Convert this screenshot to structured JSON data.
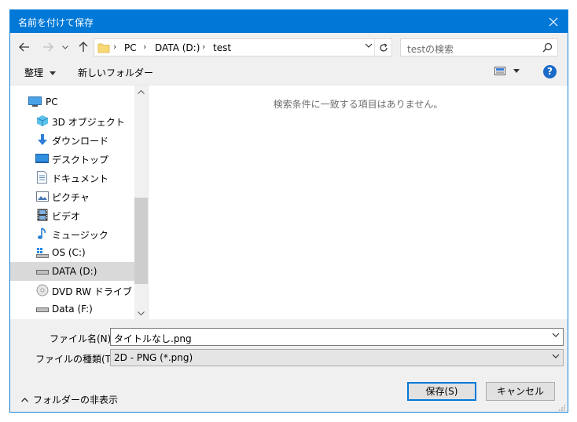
{
  "window": {
    "title": "名前を付けて保存"
  },
  "address": {
    "crumbs": [
      "PC",
      "DATA (D:)",
      "test"
    ]
  },
  "search": {
    "placeholder": "testの検索"
  },
  "toolbar": {
    "organize": "整理",
    "new_folder": "新しいフォルダー"
  },
  "nav": {
    "items": [
      {
        "label": "PC",
        "icon": "pc-icon"
      },
      {
        "label": "3D オブジェクト",
        "icon": "3d-objects-icon"
      },
      {
        "label": "ダウンロード",
        "icon": "downloads-icon"
      },
      {
        "label": "デスクトップ",
        "icon": "desktop-icon"
      },
      {
        "label": "ドキュメント",
        "icon": "documents-icon"
      },
      {
        "label": "ピクチャ",
        "icon": "pictures-icon"
      },
      {
        "label": "ビデオ",
        "icon": "videos-icon"
      },
      {
        "label": "ミュージック",
        "icon": "music-icon"
      },
      {
        "label": "OS (C:)",
        "icon": "os-drive-icon"
      },
      {
        "label": "DATA (D:)",
        "icon": "data-drive-icon",
        "selected": true
      },
      {
        "label": "DVD RW ドライブ (E:)",
        "icon": "dvd-drive-icon"
      },
      {
        "label": "Data (F:)",
        "icon": "drive-icon"
      }
    ]
  },
  "content": {
    "empty_message": "検索条件に一致する項目はありません。"
  },
  "form": {
    "filename_label": "ファイル名(N):",
    "filename_value": "タイトルなし.png",
    "filetype_label": "ファイルの種類(T):",
    "filetype_value": "2D - PNG (*.png)"
  },
  "footer": {
    "hide_folders": "フォルダーの非表示",
    "save": "保存(S)",
    "cancel": "キャンセル"
  },
  "colors": {
    "titlebar": "#0078d7",
    "accent": "#0078d7",
    "selection": "#d9d9d9"
  }
}
